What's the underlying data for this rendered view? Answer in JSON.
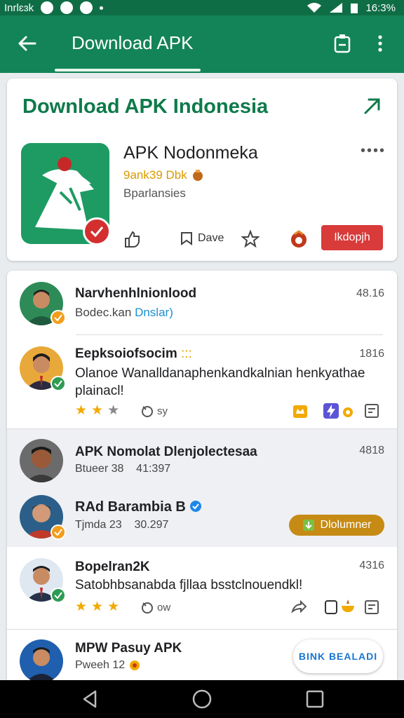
{
  "status_bar": {
    "carrier": "Inrlɛɜk",
    "time": "16:3%"
  },
  "app_bar": {
    "title": "Download APK"
  },
  "hero": {
    "title": "Download APK Indonesia",
    "app_name": "APK Nodonmeka",
    "developer": "9ank39 Dbk",
    "category": "Bparlansies",
    "save_label": "Dave",
    "install_label": "Ikdopjh"
  },
  "feed": [
    {
      "name": "Narvhenhlnionlood",
      "sub": "Bodec.kan",
      "sub_link": "Dnslar)",
      "time": "48.16"
    },
    {
      "name": "Eepksoiofsocim",
      "name_suffix": ":::",
      "body": "Olanoe Wanalldanaphenkandkalnian henkyathae plainacl!",
      "react_count": "sy",
      "time": "1816"
    },
    {
      "name": "APK Nomolat Dlenjolectesaa",
      "sub": "Btueer 38",
      "sub2": "41:397",
      "time": "4818"
    },
    {
      "name": "RAd Barambia B",
      "sub": "Tjmda 23",
      "sub2": "30.297",
      "button": "Dlolumner"
    },
    {
      "name": "Bopelran2K",
      "body": "Satobhbsanabda fjllaa bsstclnouendkl!",
      "react_count": "ow",
      "time": "4316"
    },
    {
      "name": "MPW Pasuy APK",
      "sub": "Pweeh 12",
      "button": "BINK BEALADI"
    }
  ],
  "colors": {
    "brand": "#138457",
    "accent_red": "#d93a3a",
    "star": "#f2a900"
  }
}
